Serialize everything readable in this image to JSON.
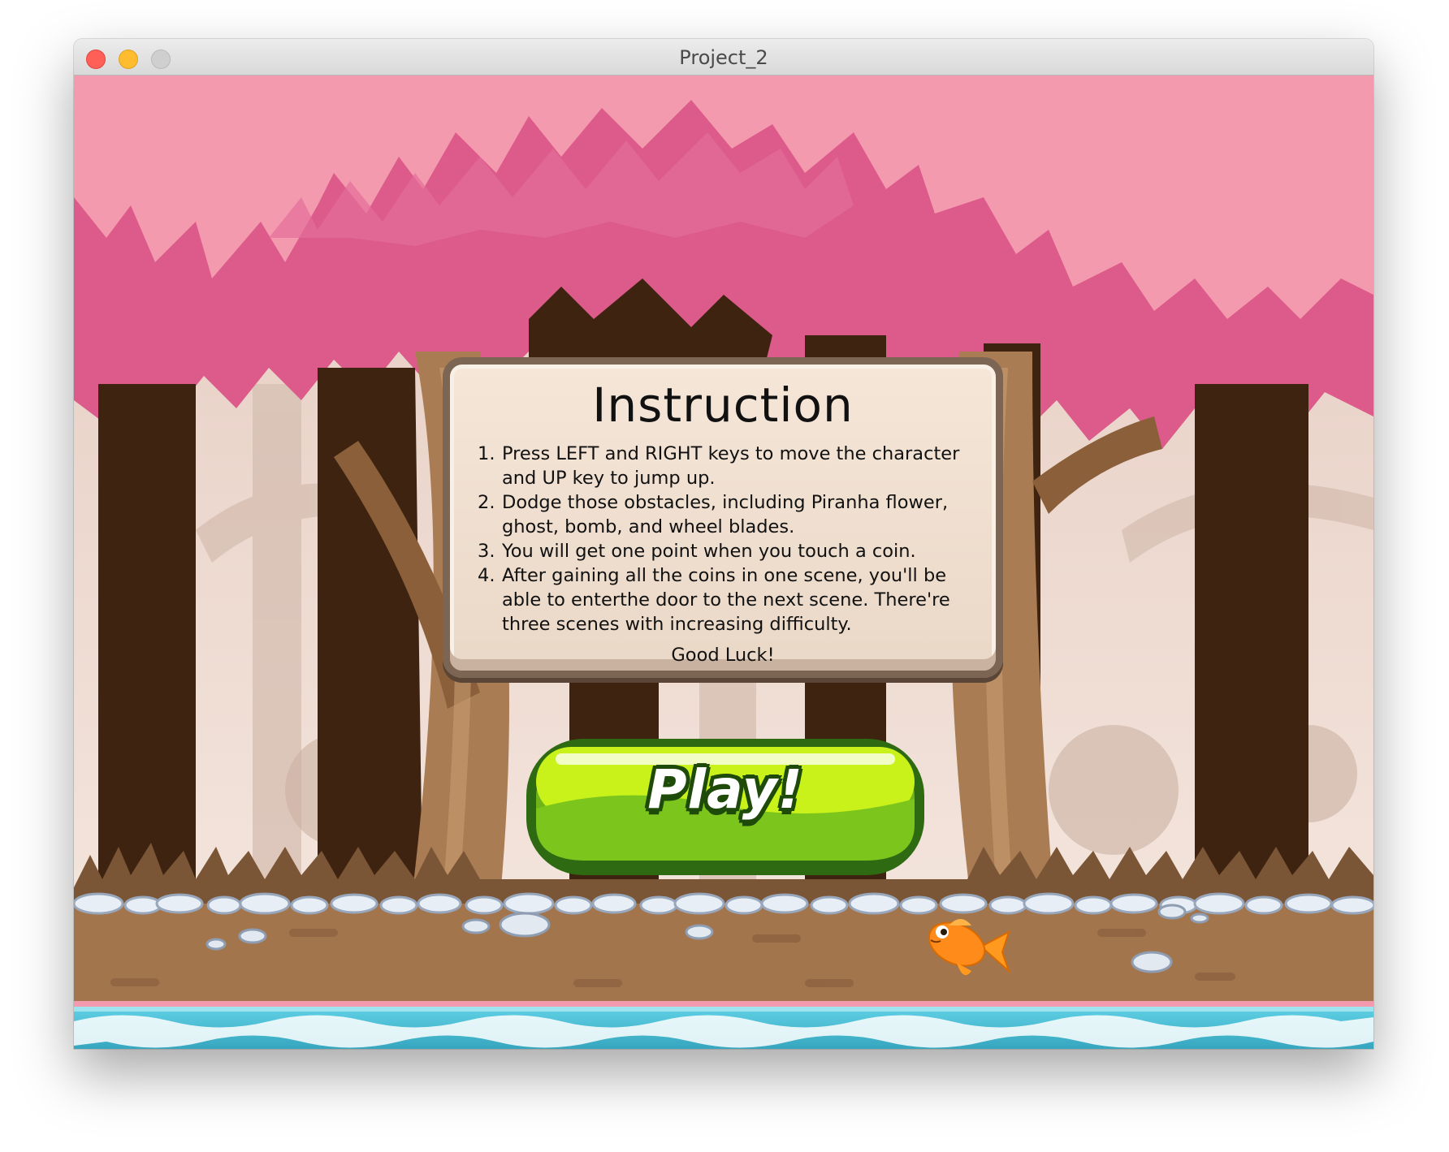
{
  "window": {
    "title": "Project_2"
  },
  "instructions": {
    "heading": "Instruction",
    "steps": [
      {
        "num": "1.",
        "text": "Press LEFT and RIGHT keys to move the character and UP key to jump up."
      },
      {
        "num": "2.",
        "text": "Dodge those obstacles, including Piranha flower, ghost, bomb, and wheel blades."
      },
      {
        "num": "3.",
        "text": "You will get one point when you touch a coin."
      },
      {
        "num": "4.",
        "text": "After gaining all the coins in one scene, you'll be able to enterthe door to the next scene. There're three scenes with increasing difficulty."
      }
    ],
    "closing": "Good Luck!"
  },
  "play_button": {
    "label": "Play!"
  },
  "scene": {
    "character": "goldfish-icon",
    "colors": {
      "sky": "#f49aaf",
      "foliage_dark": "#dc5b8a",
      "trunk_dark": "#3e2410",
      "trunk_light": "#a97c54",
      "ground": "#a3754d",
      "water": "#4fc6dc",
      "button_green": "#8ad41a",
      "button_border": "#2e6a12"
    }
  }
}
